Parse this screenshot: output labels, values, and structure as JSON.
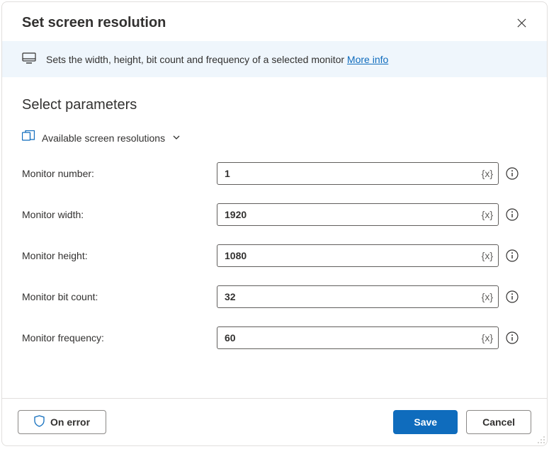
{
  "header": {
    "title": "Set screen resolution"
  },
  "banner": {
    "text": "Sets the width, height, bit count and frequency of a selected monitor ",
    "link_label": "More info"
  },
  "section": {
    "title": "Select parameters",
    "variables_label": "Available screen resolutions"
  },
  "fields": {
    "monitor_number": {
      "label": "Monitor number:",
      "value": "1"
    },
    "monitor_width": {
      "label": "Monitor width:",
      "value": "1920"
    },
    "monitor_height": {
      "label": "Monitor height:",
      "value": "1080"
    },
    "monitor_bit_count": {
      "label": "Monitor bit count:",
      "value": "32"
    },
    "monitor_frequency": {
      "label": "Monitor frequency:",
      "value": "60"
    }
  },
  "var_token": "{x}",
  "footer": {
    "on_error": "On error",
    "save": "Save",
    "cancel": "Cancel"
  }
}
